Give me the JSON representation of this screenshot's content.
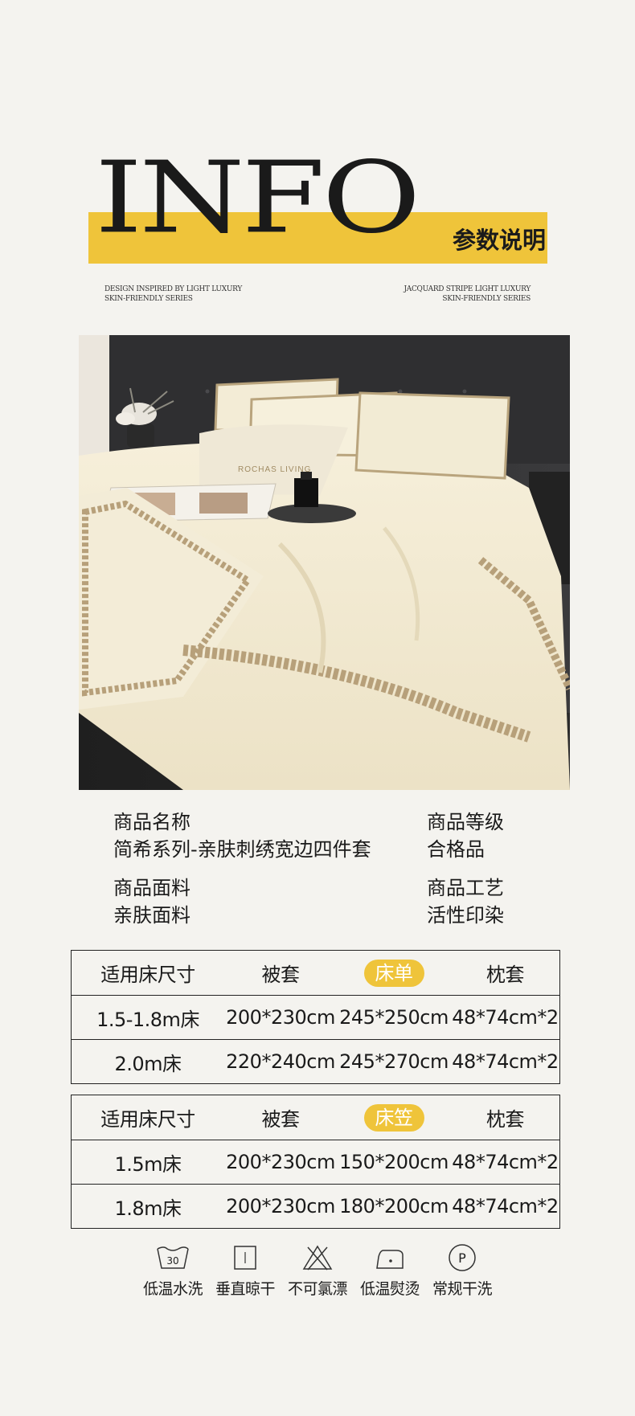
{
  "header": {
    "title": "INFO",
    "subtitle": "参数说明",
    "tagline_left": [
      "DESIGN INSPIRED BY LIGHT LUXURY",
      "SKIN-FRIENDLY SERIES"
    ],
    "tagline_right": [
      "JACQUARD STRIPE LIGHT LUXURY",
      "SKIN-FRIENDLY SERIES"
    ]
  },
  "photo": {
    "pillow_text": "ROCHAS LIVING"
  },
  "info": {
    "name_label": "商品名称",
    "name_value": "简希系列-亲肤刺绣宽边四件套",
    "grade_label": "商品等级",
    "grade_value": "合格品",
    "fabric_label": "商品面料",
    "fabric_value": "亲肤面料",
    "craft_label": "商品工艺",
    "craft_value": "活性印染"
  },
  "table1": {
    "headers": [
      "适用床尺寸",
      "被套",
      "床单",
      "枕套"
    ],
    "rows": [
      [
        "1.5-1.8m床",
        "200*230cm",
        "245*250cm",
        "48*74cm*2"
      ],
      [
        "2.0m床",
        "220*240cm",
        "245*270cm",
        "48*74cm*2"
      ]
    ]
  },
  "table2": {
    "headers": [
      "适用床尺寸",
      "被套",
      "床笠",
      "枕套"
    ],
    "rows": [
      [
        "1.5m床",
        "200*230cm",
        "150*200cm",
        "48*74cm*2"
      ],
      [
        "1.8m床",
        "200*230cm",
        "180*200cm",
        "48*74cm*2"
      ]
    ]
  },
  "care": [
    {
      "label": "低温水洗",
      "icon": "wash-30-icon",
      "icon_text": "30"
    },
    {
      "label": "垂直晾干",
      "icon": "hang-dry-icon"
    },
    {
      "label": "不可氯漂",
      "icon": "no-bleach-icon"
    },
    {
      "label": "低温熨烫",
      "icon": "low-iron-icon"
    },
    {
      "label": "常规干洗",
      "icon": "dry-clean-p-icon",
      "icon_text": "P"
    }
  ],
  "colors": {
    "accent": "#efc43a",
    "background": "#f4f3ef",
    "text": "#1a1a1a"
  }
}
